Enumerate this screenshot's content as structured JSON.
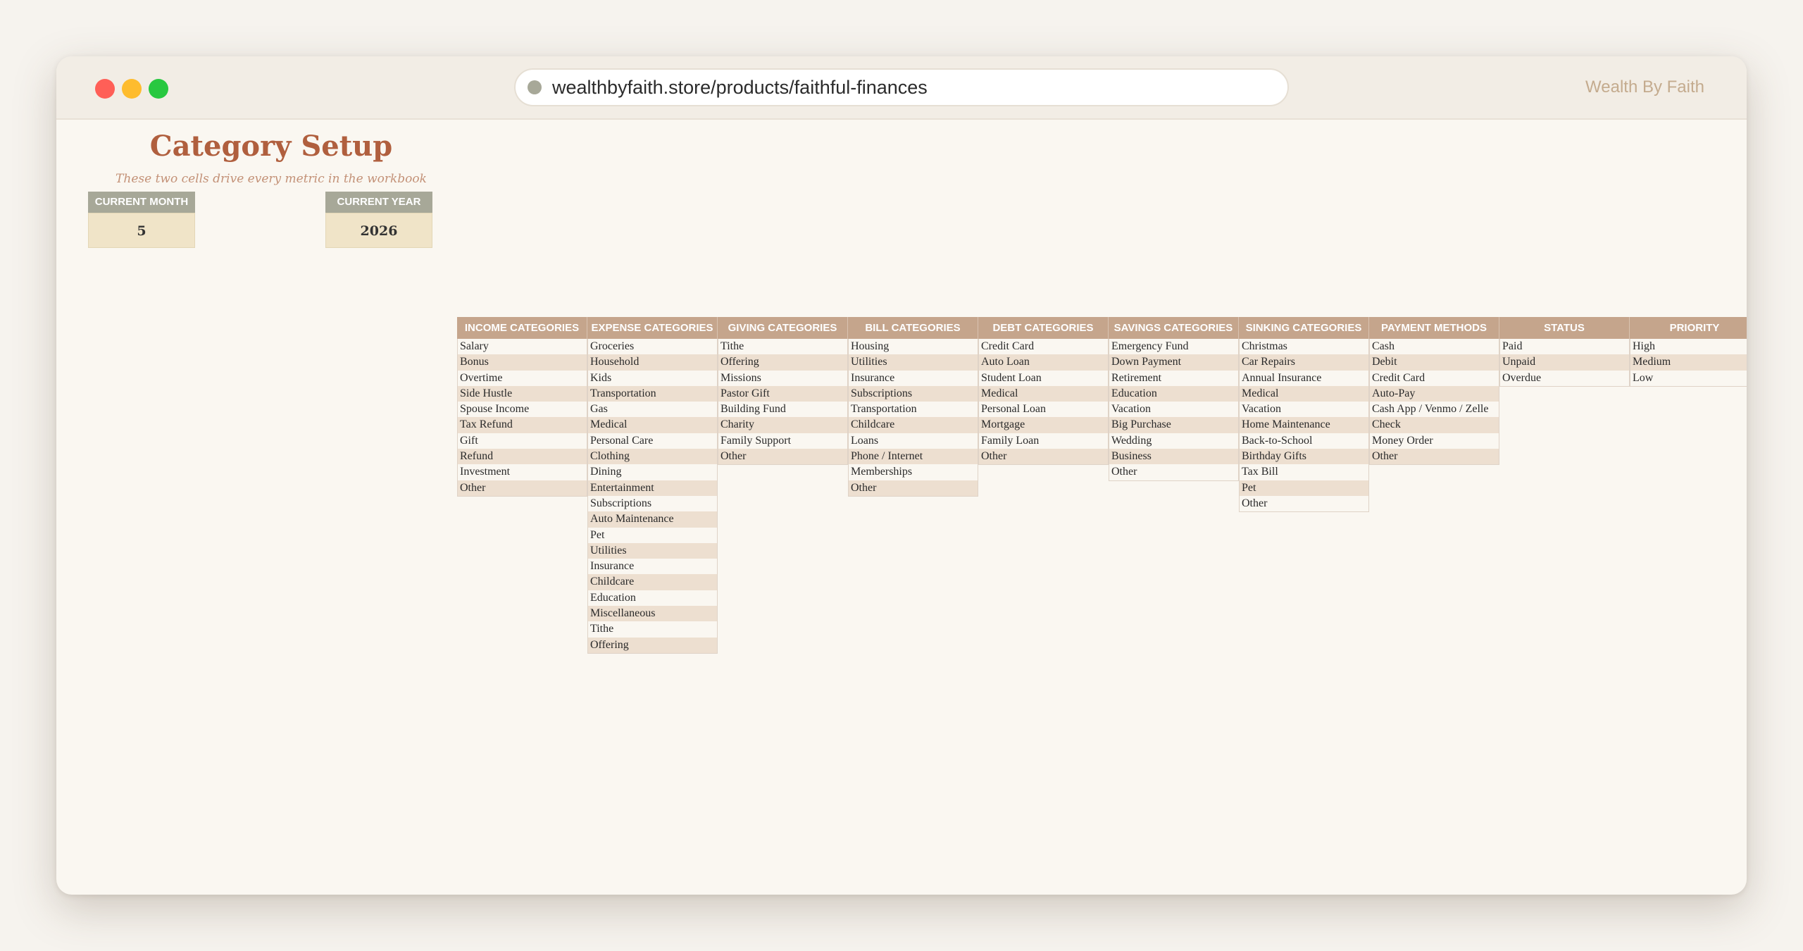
{
  "browser": {
    "url": "wealthbyfaith.store/products/faithful-finances",
    "brand": "Wealth By Faith"
  },
  "header": {
    "title": "Category Setup",
    "subtitle": "These two cells drive every metric in the workbook"
  },
  "params": {
    "month_label": "CURRENT MONTH",
    "month_value": "5",
    "year_label": "CURRENT YEAR",
    "year_value": "2026"
  },
  "columns": [
    {
      "header": "INCOME CATEGORIES",
      "items": [
        "Salary",
        "Bonus",
        "Overtime",
        "Side Hustle",
        "Spouse Income",
        "Tax Refund",
        "Gift",
        "Refund",
        "Investment",
        "Other"
      ]
    },
    {
      "header": "EXPENSE CATEGORIES",
      "items": [
        "Groceries",
        "Household",
        "Kids",
        "Transportation",
        "Gas",
        "Medical",
        "Personal Care",
        "Clothing",
        "Dining",
        "Entertainment",
        "Subscriptions",
        "Auto Maintenance",
        "Pet",
        "Utilities",
        "Insurance",
        "Childcare",
        "Education",
        "Miscellaneous",
        "Tithe",
        "Offering"
      ]
    },
    {
      "header": "GIVING CATEGORIES",
      "items": [
        "Tithe",
        "Offering",
        "Missions",
        "Pastor Gift",
        "Building Fund",
        "Charity",
        "Family Support",
        "Other"
      ]
    },
    {
      "header": "BILL CATEGORIES",
      "items": [
        "Housing",
        "Utilities",
        "Insurance",
        "Subscriptions",
        "Transportation",
        "Childcare",
        "Loans",
        "Phone / Internet",
        "Memberships",
        "Other"
      ]
    },
    {
      "header": "DEBT CATEGORIES",
      "items": [
        "Credit Card",
        "Auto Loan",
        "Student Loan",
        "Medical",
        "Personal Loan",
        "Mortgage",
        "Family Loan",
        "Other"
      ]
    },
    {
      "header": "SAVINGS CATEGORIES",
      "items": [
        "Emergency Fund",
        "Down Payment",
        "Retirement",
        "Education",
        "Vacation",
        "Big Purchase",
        "Wedding",
        "Business",
        "Other"
      ]
    },
    {
      "header": "SINKING CATEGORIES",
      "items": [
        "Christmas",
        "Car Repairs",
        "Annual Insurance",
        "Medical",
        "Vacation",
        "Home Maintenance",
        "Back-to-School",
        "Birthday Gifts",
        "Tax Bill",
        "Pet",
        "Other"
      ]
    },
    {
      "header": "PAYMENT METHODS",
      "items": [
        "Cash",
        "Debit",
        "Credit Card",
        "Auto-Pay",
        "Cash App / Venmo / Zelle",
        "Check",
        "Money Order",
        "Other"
      ]
    },
    {
      "header": "STATUS",
      "items": [
        "Paid",
        "Unpaid",
        "Overdue"
      ]
    },
    {
      "header": "PRIORITY",
      "items": [
        "High",
        "Medium",
        "Low"
      ]
    }
  ]
}
